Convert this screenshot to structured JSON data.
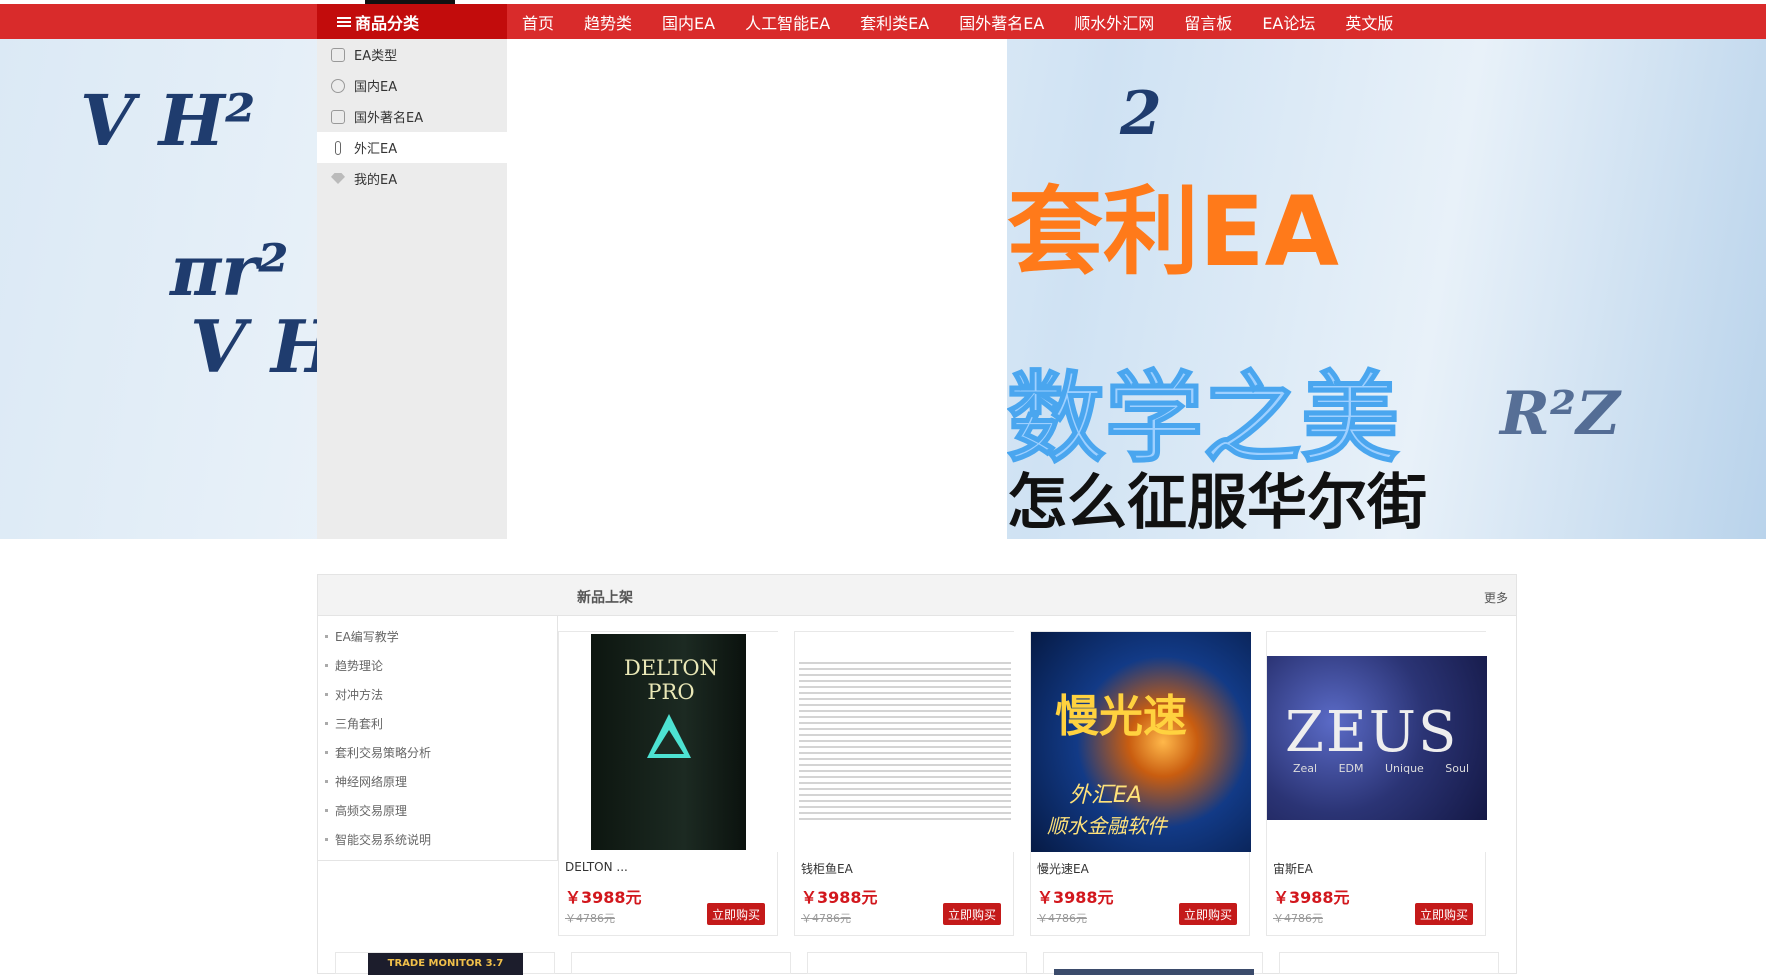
{
  "nav": {
    "category_label": "商品分类",
    "items": [
      "首页",
      "趋势类",
      "国内EA",
      "人工智能EA",
      "套利类EA",
      "国外著名EA",
      "顺水外汇网",
      "留言板",
      "EA论坛",
      "英文版"
    ]
  },
  "categories": [
    {
      "label": "EA类型",
      "icon": "flask-icon"
    },
    {
      "label": "国内EA",
      "icon": "badge-icon"
    },
    {
      "label": "国外著名EA",
      "icon": "chart-icon"
    },
    {
      "label": "外汇EA",
      "icon": "tube-icon"
    },
    {
      "label": "我的EA",
      "icon": "diamond-icon"
    }
  ],
  "banner": {
    "title_orange": "套利EA",
    "title_blue": "数学之美",
    "title_black": "怎么征服华尔街"
  },
  "panel": {
    "title": "新品上架",
    "more": "更多",
    "side_links": [
      "EA编写教学",
      "趋势理论",
      "对冲方法",
      "三角套利",
      "套利交易策略分析",
      "神经网络原理",
      "高频交易原理",
      "智能交易系统说明"
    ]
  },
  "products": [
    {
      "name": "DELTON ...",
      "price": "￥3988元",
      "old_price": "￥4786元",
      "buy": "立即购买",
      "thumb_text": "DELTON PRO"
    },
    {
      "name": "钱柜鱼EA",
      "price": "￥3988元",
      "old_price": "￥4786元",
      "buy": "立即购买",
      "thumb_text": ""
    },
    {
      "name": "慢光速EA",
      "price": "￥3988元",
      "old_price": "￥4786元",
      "buy": "立即购买",
      "thumb_text": "慢光速",
      "thumb_sub1": "外汇EA",
      "thumb_sub2": "顺水金融软件"
    },
    {
      "name": "宙斯EA",
      "price": "￥3988元",
      "old_price": "￥4786元",
      "buy": "立即购买",
      "thumb_text": "ZEUS",
      "thumb_sub1": "Zeal EDM Unique Soul"
    }
  ],
  "peek_row": {
    "first_thumb_text": "TRADE MONITOR 3.7"
  },
  "colors": {
    "nav": "#d92b2b",
    "nav_category": "#c20c0c",
    "price": "#d2171d",
    "buy_button": "#c41a1a",
    "banner_orange": "#ff7a1a",
    "banner_blue": "#9fd0ff"
  }
}
